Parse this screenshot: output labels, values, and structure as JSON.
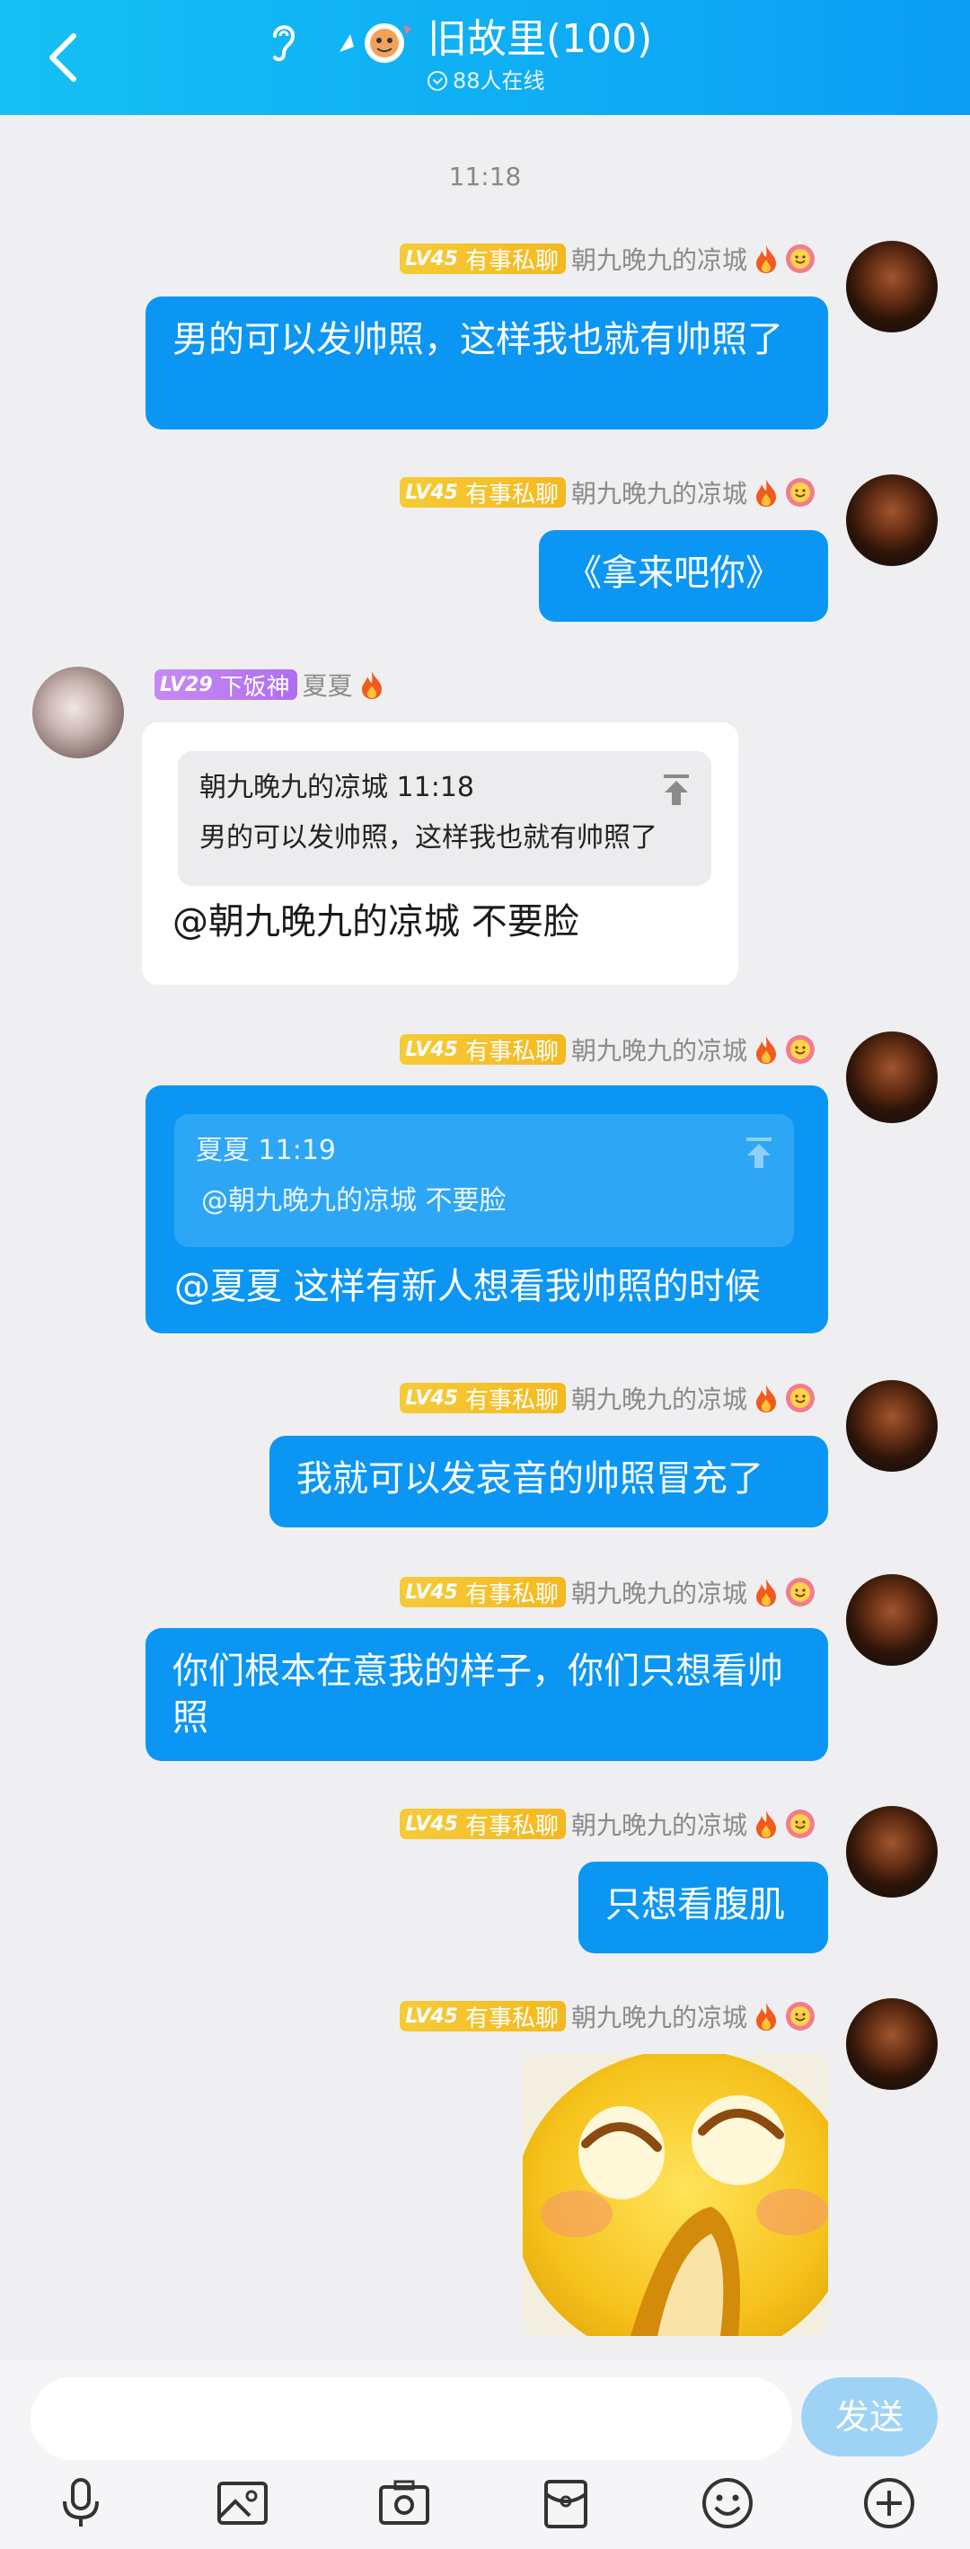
{
  "header": {
    "back_label": "back",
    "title": "旧故里(100)",
    "online": "88人在线"
  },
  "time_label": "11:18",
  "colors": {
    "header_start": "#14c0f3",
    "header_end": "#0c9ef5",
    "bubble_out": "#0b96f4",
    "badge_gold": "#f5b81e",
    "badge_purple": "#b06df0"
  },
  "messages": [
    {
      "sender": "朝九晚九的凉城",
      "level": "LV45",
      "title_badge": "有事私聊",
      "text": "男的可以发帅照，这样我也就有帅照了"
    },
    {
      "sender": "朝九晚九的凉城",
      "level": "LV45",
      "title_badge": "有事私聊",
      "text": "《拿来吧你》"
    },
    {
      "sender": "夏夏",
      "level": "LV29",
      "title_badge": "下饭神",
      "quote_header": "朝九晚九的凉城 11:18",
      "quote_text": "男的可以发帅照，这样我也就有帅照了",
      "text": "@朝九晚九的凉城 不要脸"
    },
    {
      "sender": "朝九晚九的凉城",
      "level": "LV45",
      "title_badge": "有事私聊",
      "quote_header": "夏夏 11:19",
      "quote_text": "@朝九晚九的凉城 不要脸",
      "text": "@夏夏 这样有新人想看我帅照的时候"
    },
    {
      "sender": "朝九晚九的凉城",
      "level": "LV45",
      "title_badge": "有事私聊",
      "text": "我就可以发哀音的帅照冒充了"
    },
    {
      "sender": "朝九晚九的凉城",
      "level": "LV45",
      "title_badge": "有事私聊",
      "text": "你们根本在意我的样子，你们只想看帅照"
    },
    {
      "sender": "朝九晚九的凉城",
      "level": "LV45",
      "title_badge": "有事私聊",
      "text": "只想看腹肌"
    },
    {
      "sender": "朝九晚九的凉城",
      "level": "LV45",
      "title_badge": "有事私聊",
      "sticker": "crying-emoji-sticker"
    }
  ],
  "input": {
    "placeholder": "",
    "send_label": "发送"
  },
  "toolbar": [
    "mic-icon",
    "image-icon",
    "camera-icon",
    "red-packet-icon",
    "emoji-icon",
    "plus-icon"
  ]
}
